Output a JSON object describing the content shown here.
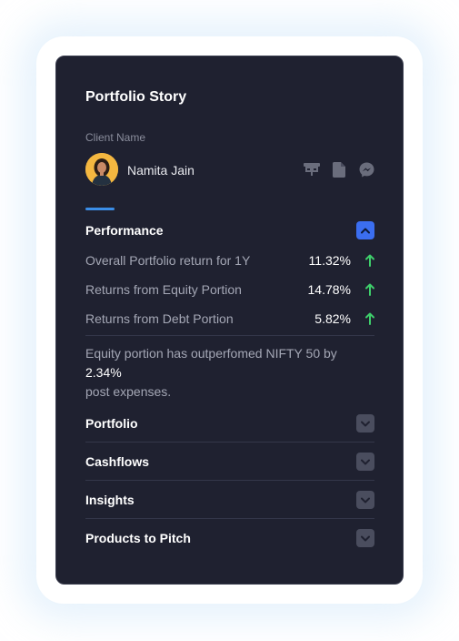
{
  "card": {
    "title": "Portfolio Story",
    "client_label": "Client Name",
    "client_name": "Namita Jain",
    "action_icons": [
      "presentation-icon",
      "document-icon",
      "messenger-icon"
    ]
  },
  "performance": {
    "title": "Performance",
    "expanded": true,
    "metrics": [
      {
        "label": "Overall Portfolio return for 1Y",
        "value": "11.32%",
        "trend": "up"
      },
      {
        "label": "Returns from Equity Portion",
        "value": "14.78%",
        "trend": "up"
      },
      {
        "label": "Returns from Debt Portion",
        "value": "5.82%",
        "trend": "up"
      }
    ],
    "note_prefix": "Equity portion has outperfomed NIFTY 50 by ",
    "note_highlight": "2.34%",
    "note_suffix": "post expenses."
  },
  "sections": [
    {
      "title": "Portfolio",
      "expanded": false
    },
    {
      "title": "Cashflows",
      "expanded": false
    },
    {
      "title": "Insights",
      "expanded": false
    },
    {
      "title": "Products to Pitch",
      "expanded": false
    }
  ],
  "colors": {
    "card_bg": "#1f2130",
    "accent": "#3b8ee8",
    "toggle_open": "#3b6ef0",
    "up_arrow": "#3ecf6b"
  }
}
